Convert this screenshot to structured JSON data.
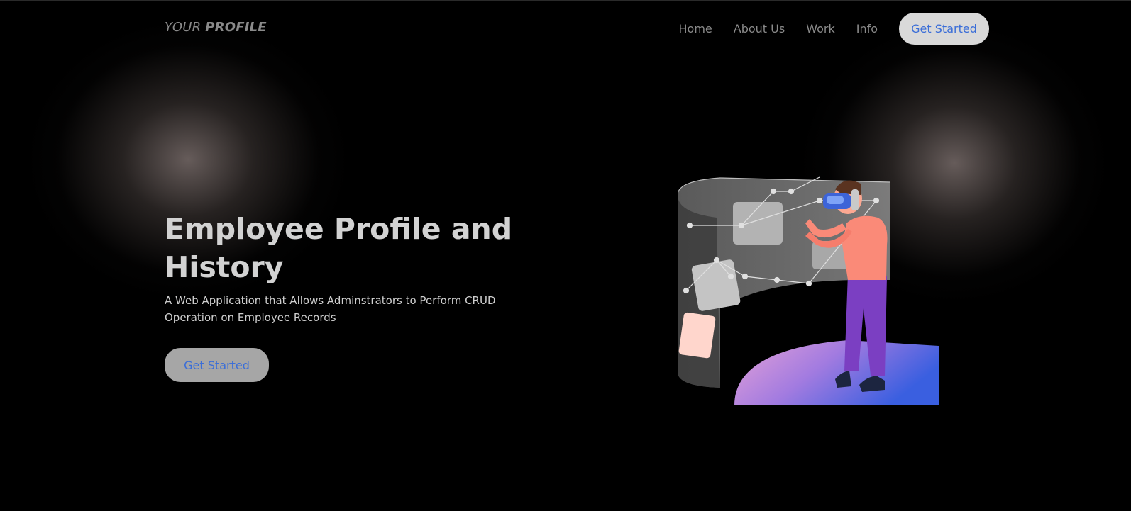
{
  "brand": {
    "logo_light": "YOUR",
    "logo_bold": "PROFILE"
  },
  "nav": {
    "items": [
      "Home",
      "About Us",
      "Work",
      "Info"
    ],
    "cta_label": "Get Started"
  },
  "hero": {
    "title": "Employee Profile and History",
    "subtitle": "A Web Application that Allows Adminstrators to Perform CRUD Operation on Employee Records",
    "cta_label": "Get Started"
  },
  "illustration": {
    "icon": "vr-user-illustration"
  },
  "colors": {
    "background": "#000000",
    "accent": "#3b6ed8",
    "button_bg": "#d9d9d9",
    "hero_button_bg": "#a6a6a6"
  }
}
